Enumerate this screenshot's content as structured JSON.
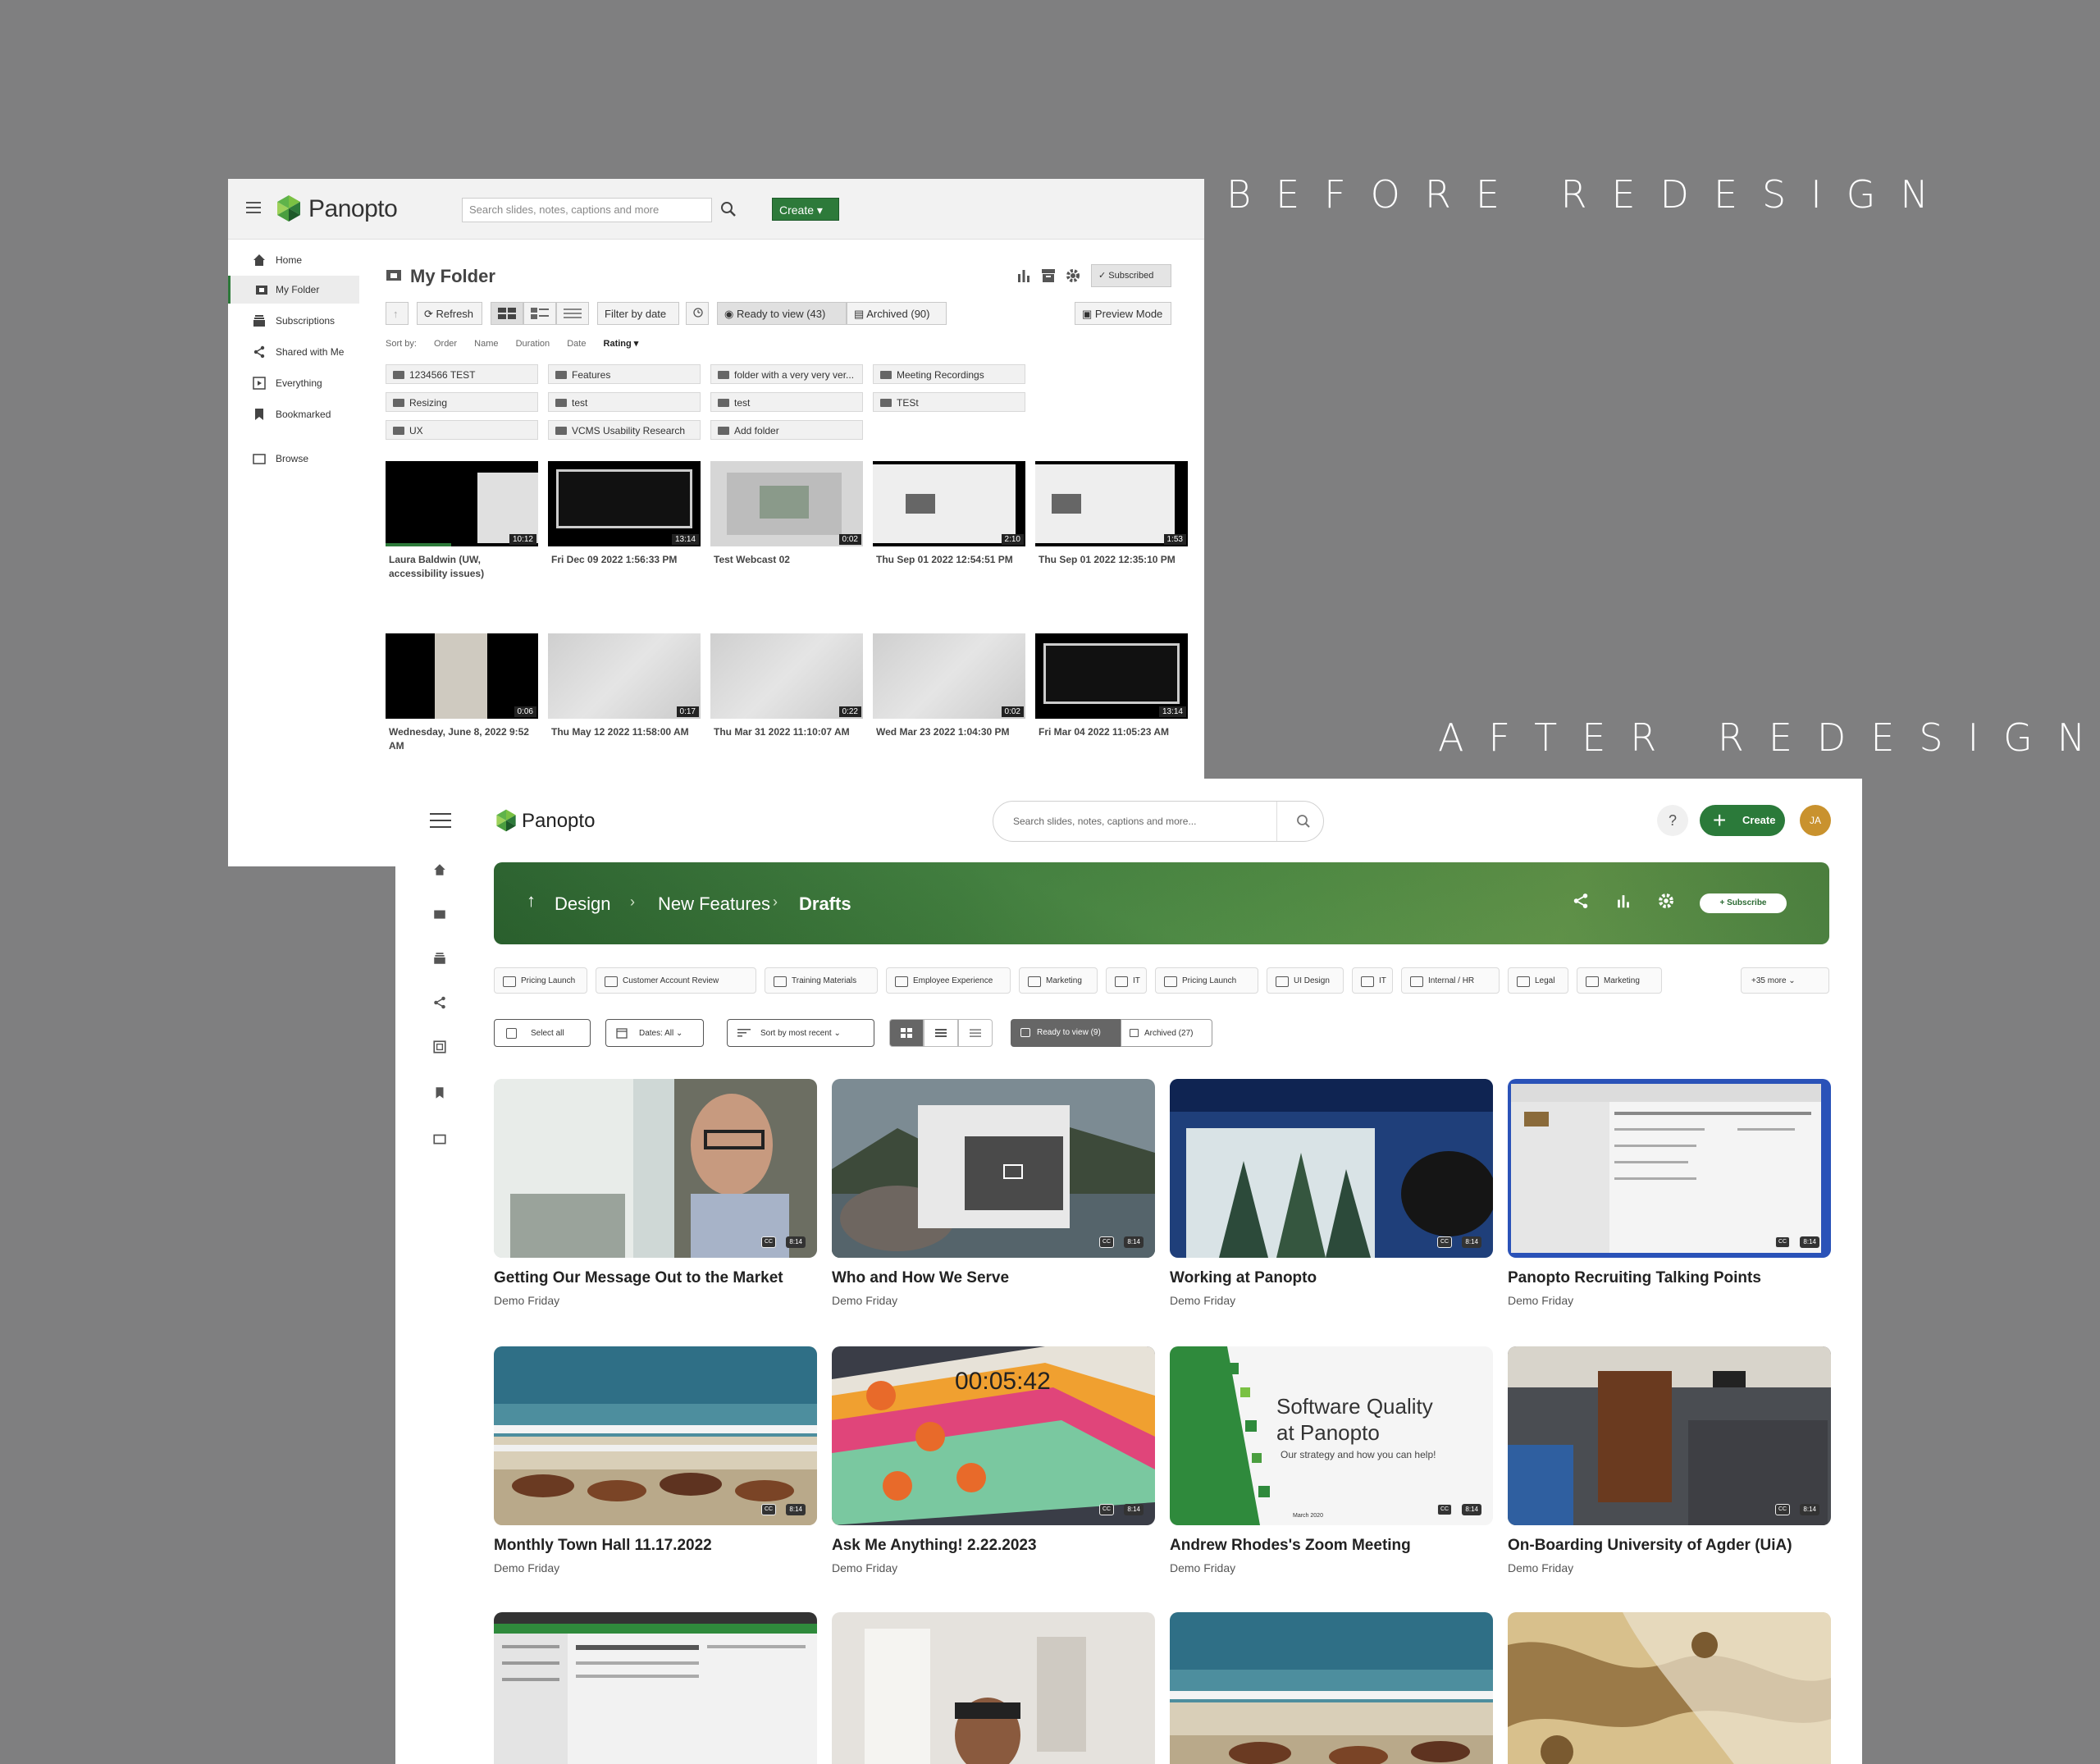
{
  "headings": {
    "before": "BEFORE REDESIGN",
    "after": "AFTER REDESIGN"
  },
  "before": {
    "logo_text": "Panopto",
    "search_placeholder": "Search slides, notes, captions and more",
    "create_label": "Create ▾",
    "sidebar": [
      {
        "label": "Home",
        "icon": "home-icon"
      },
      {
        "label": "My Folder",
        "icon": "folder-icon",
        "active": true
      },
      {
        "label": "Subscriptions",
        "icon": "subscriptions-icon"
      },
      {
        "label": "Shared with Me",
        "icon": "share-icon"
      },
      {
        "label": "Everything",
        "icon": "everything-icon"
      },
      {
        "label": "Bookmarked",
        "icon": "bookmark-icon"
      },
      {
        "label": "Browse",
        "icon": "browse-folder-icon"
      }
    ],
    "title": "My Folder",
    "toolbar": {
      "refresh": "Refresh",
      "filter": "Filter by date",
      "ready": "Ready to view (43)",
      "archived": "Archived (90)",
      "preview": "Preview Mode",
      "subscribed": "Subscribed"
    },
    "sort": {
      "label": "Sort by:",
      "options": [
        "Order",
        "Name",
        "Duration",
        "Date",
        "Rating ▾"
      ]
    },
    "folders": [
      "1234566 TEST",
      "Features",
      "folder with a very very ver...",
      "Meeting Recordings",
      "Resizing",
      "test",
      "test",
      "TESt",
      "UX",
      "VCMS Usability Research",
      "Add folder"
    ],
    "videos": [
      {
        "title": "Laura Baldwin (UW, accessibility issues)",
        "duration": "10:12"
      },
      {
        "title": "Fri Dec 09 2022 1:56:33 PM",
        "duration": "13:14"
      },
      {
        "title": "Test Webcast 02",
        "duration": "0:02"
      },
      {
        "title": "Thu Sep 01 2022 12:54:51 PM",
        "duration": "2:10"
      },
      {
        "title": "Thu Sep 01 2022 12:35:10 PM",
        "duration": "1:53"
      },
      {
        "title": "Wednesday, June 8, 2022 9:52 AM",
        "duration": "0:06"
      },
      {
        "title": "Thu May 12 2022 11:58:00 AM",
        "duration": "0:17"
      },
      {
        "title": "Thu Mar 31 2022 11:10:07 AM",
        "duration": "0:22"
      },
      {
        "title": "Wed Mar 23 2022 1:04:30 PM",
        "duration": "0:02"
      },
      {
        "title": "Fri Mar 04 2022 11:05:23 AM",
        "duration": "13:14"
      }
    ]
  },
  "after": {
    "logo_text": "Panopto",
    "search_placeholder": "Search slides, notes, captions and more...",
    "help": "?",
    "create_label": "Create",
    "avatar": "JA",
    "breadcrumb": [
      "Design",
      "New Features",
      "Drafts"
    ],
    "subscribe_label": "+ Subscribe",
    "chips": [
      "Pricing Launch",
      "Customer Account Review",
      "Training Materials",
      "Employee Experience",
      "Marketing",
      "IT",
      "Pricing Launch",
      "UI Design",
      "IT",
      "Internal / HR",
      "Legal",
      "Marketing",
      "+35 more ⌄"
    ],
    "controls": {
      "select_all": "Select all",
      "dates": "Dates: All ⌄",
      "sort": "Sort by most recent ⌄",
      "ready": "Ready to view (9)",
      "archived": "Archived (27)"
    },
    "videos": [
      {
        "title": "Getting Our Message Out to the Market",
        "subtitle": "Demo Friday",
        "duration": "8:14"
      },
      {
        "title": "Who and How We Serve",
        "subtitle": "Demo Friday",
        "duration": "8:14"
      },
      {
        "title": "Working at Panopto",
        "subtitle": "Demo Friday",
        "duration": "8:14"
      },
      {
        "title": "Panopto Recruiting Talking Points",
        "subtitle": "Demo Friday",
        "duration": "8:14"
      },
      {
        "title": "Monthly Town Hall 11.17.2022",
        "subtitle": "Demo Friday",
        "duration": "8:14"
      },
      {
        "title": "Ask Me Anything! 2.22.2023",
        "subtitle": "Demo Friday",
        "duration": "8:14"
      },
      {
        "title": "Andrew Rhodes's Zoom Meeting",
        "subtitle": "Demo Friday",
        "duration": "8:14"
      },
      {
        "title": "On-Boarding University of Agder (UiA)",
        "subtitle": "Demo Friday",
        "duration": "8:14"
      }
    ],
    "thumb_text": {
      "timer": "00:05:42",
      "slide_title_1": "Software Quality",
      "slide_title_2": "at Panopto",
      "slide_sub": "Our strategy and how you can help!",
      "slide_date": "March 2020"
    },
    "cc_label": "CC",
    "colors": {
      "brand_green": "#2b7a3a",
      "avatar": "#c9922e"
    }
  }
}
